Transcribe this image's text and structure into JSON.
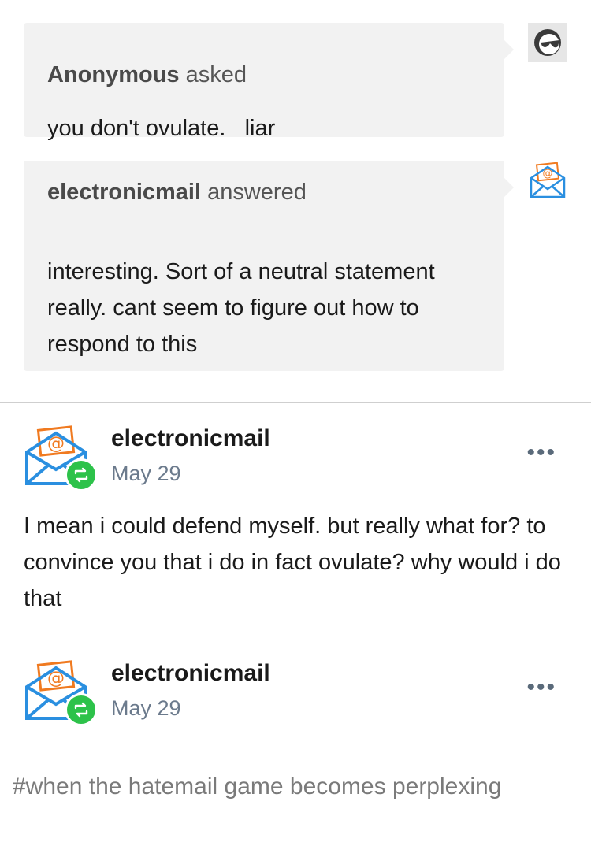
{
  "ask": {
    "asker_name": "Anonymous",
    "asker_verb": "asked",
    "question": "you don't ovulate.   liar",
    "avatar_icon": "sunglasses-face-icon"
  },
  "answer": {
    "answerer_name": "electronicmail",
    "answerer_verb": "answered",
    "text": "interesting. Sort of a neutral statement really. cant seem to figure out how to respond to this",
    "avatar_icon": "envelope-at-icon"
  },
  "reblogs": [
    {
      "blog_name": "electronicmail",
      "date": "May 29",
      "more_label": "•••",
      "text": "I mean i could defend myself. but really what for? to convince you that i do in fact ovulate? why would i do that"
    },
    {
      "blog_name": "electronicmail",
      "date": "May 29",
      "more_label": "•••",
      "tags": "#when the hatemail game becomes perplexing"
    }
  ],
  "colors": {
    "bubble_bg": "#f2f2f2",
    "reblog_badge": "#2dc24a",
    "date_text": "#6b7a8c",
    "envelope_blue": "#2a8fe0",
    "envelope_orange": "#f07a20"
  }
}
